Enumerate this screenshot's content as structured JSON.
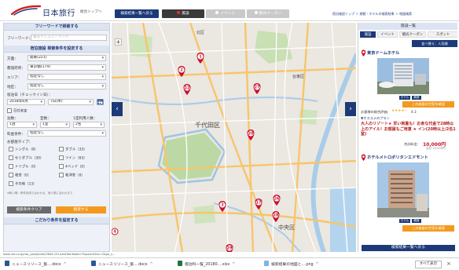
{
  "header": {
    "logo_text": "日本旅行",
    "home_link": "総合トップへ",
    "back_to_list": "検索結果一覧へ戻る",
    "tabs": [
      {
        "label": "施設",
        "dot_color": "#e03131"
      },
      {
        "label": "イベント",
        "dot_color": "#ffffff"
      },
      {
        "label": "観光クーポン",
        "dot_color": "#ffffff"
      }
    ],
    "breadcrumb": "宿泊施設トップ ＞ 旅館・ホテルの検索結果 ＞ 地図検索"
  },
  "left_panel": {
    "freeword_header": "フリーワードで検索する",
    "freeword_label": "フリーワード：",
    "freeword_placeholder": "東京ディズニーランド",
    "conditions_header": "宿泊施設 検索条件を設定する",
    "region_label": "方面：",
    "region_value": "関東(221)",
    "prefecture_label": "都道府県：",
    "prefecture_value": "東京都(174)",
    "area_label": "エリア：",
    "area_value": "指定なし",
    "district_label": "地区：",
    "district_value": "指定なし",
    "date_label": "宿泊日（チェックイン日）：",
    "date_value": "2018年6月",
    "day_value": "7日(木)",
    "undecided": "日付未定",
    "nights_label": "泊数：",
    "nights_value": "1泊",
    "rooms_label": "室数：",
    "rooms_value": "1室",
    "guests_label": "1室利用人数：",
    "guests_value": "2名",
    "price_label": "料金条件：",
    "price_value": "指定なし",
    "roomtype_label": "お部屋タイプ：",
    "room_types": [
      "シングル（8）",
      "ダブル（33）",
      "セミダブル（30）",
      "ツイン（63）",
      "トリプル（0）",
      "4ベッド（0）",
      "和室（0）",
      "和洋室（0）",
      "その他（13）"
    ],
    "note": "※和い間・条件利用ではわかる、他人割に合わせまで",
    "clear_button": "検索条件クリア",
    "search_button": "検索する",
    "detail_header": "こだわり条件を設定する"
  },
  "map": {
    "area_labels": [
      "千代田区",
      "中央区",
      "北区",
      "台東区"
    ],
    "pins": [
      {
        "n": "1"
      },
      {
        "n": "2"
      },
      {
        "n": "3"
      },
      {
        "n": "17"
      },
      {
        "n": "20"
      },
      {
        "n": "22"
      },
      {
        "n": "26"
      },
      {
        "n": "27"
      },
      {
        "n": "28"
      },
      {
        "n": "29"
      },
      {
        "n": "4"
      }
    ],
    "zoom_in": "+"
  },
  "right_panel": {
    "header": "施設一覧",
    "tabs": [
      "施設",
      "イベント",
      "観光クーポン",
      "スポット"
    ],
    "sort_button": "並べ替え：人気順",
    "hotel1": {
      "name": "東京ドームホテル",
      "badge1": "ホテル",
      "badge2": "朝食",
      "button": "この施設の空室を確認"
    },
    "review_label": "お客様の総合評価：",
    "stars": "★★★★☆",
    "score": "4.3",
    "plan_header": "▼オススメのプラン",
    "plan_text": "大人のリゾート★ 早い到着も！お食な代金で28時以上のアイル！お部屋もご用意 ★ イン(20時以上/2名1室)",
    "price_label": "合計料金：",
    "price": "10,000円",
    "price_old": "合計 20,000円",
    "hotel2": {
      "name": "ホテルメトロポリタンエドモント",
      "badge1": "ホテル",
      "badge2": "朝食",
      "button": "この施設の空室を確認"
    },
    "back_button": "検索結果一覧へ戻る"
  },
  "url_strip": "www.nta.co.jp/nta_yado/hotel/3649-101/shiaTomKoble+Populer&Fav=2&pa_s...",
  "downloads": [
    {
      "name": "ニュースリリース_第....docx",
      "type": "doc"
    },
    {
      "name": "ニュースリリース_第....docx",
      "type": "doc"
    },
    {
      "name": "宿泊料一覧_20180....xlsx",
      "type": "doc"
    },
    {
      "name": "検索結果の地図と....png",
      "type": "img"
    }
  ],
  "downloads_show_all": "すべて表示",
  "downloads_close": "×"
}
